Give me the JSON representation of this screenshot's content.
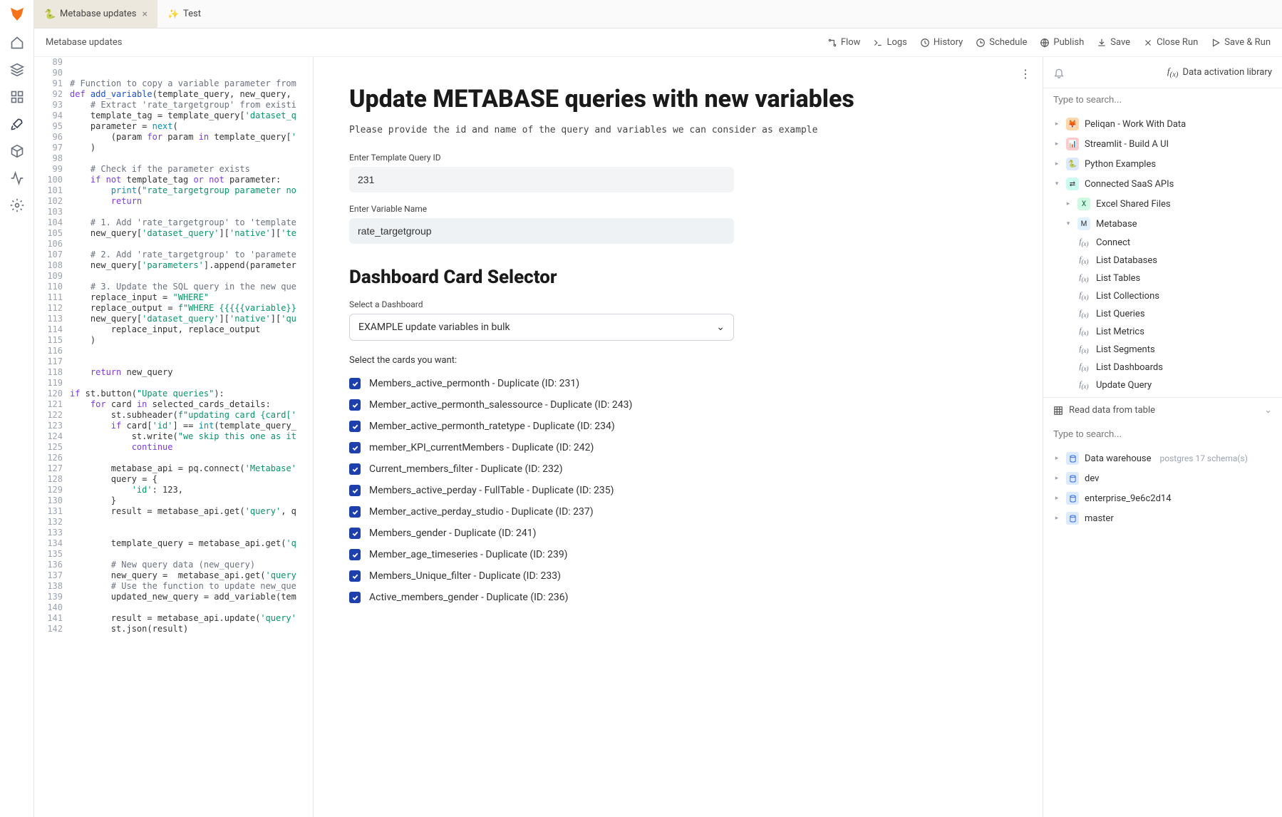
{
  "tabs": [
    {
      "label": "Metabase updates",
      "active": true
    },
    {
      "label": "Test",
      "active": false
    }
  ],
  "breadcrumb": "Metabase updates",
  "toolbar": {
    "flow": "Flow",
    "logs": "Logs",
    "history": "History",
    "schedule": "Schedule",
    "publish": "Publish",
    "save": "Save",
    "close_run": "Close Run",
    "save_run": "Save & Run"
  },
  "code": [
    {
      "n": 89,
      "t": ""
    },
    {
      "n": 90,
      "t": ""
    },
    {
      "n": 91,
      "t": "<span class='tok-comment'># Function to copy a variable parameter from</span>"
    },
    {
      "n": 92,
      "t": "<span class='tok-keyword'>def</span> <span class='tok-def'>add_variable</span>(template_query, new_query,"
    },
    {
      "n": 93,
      "t": "    <span class='tok-comment'># Extract 'rate_targetgroup' from existi</span>"
    },
    {
      "n": 94,
      "t": "    template_tag = template_query[<span class='tok-string'>'dataset_q</span>"
    },
    {
      "n": 95,
      "t": "    parameter = <span class='tok-builtin'>next</span>("
    },
    {
      "n": 96,
      "t": "        (param <span class='tok-keyword'>for</span> param <span class='tok-keyword'>in</span> template_query[<span class='tok-string'>'</span>"
    },
    {
      "n": 97,
      "t": "    )"
    },
    {
      "n": 98,
      "t": ""
    },
    {
      "n": 99,
      "t": "    <span class='tok-comment'># Check if the parameter exists</span>"
    },
    {
      "n": 100,
      "t": "    <span class='tok-keyword'>if</span> <span class='tok-keyword'>not</span> template_tag <span class='tok-keyword'>or</span> <span class='tok-keyword'>not</span> parameter:"
    },
    {
      "n": 101,
      "t": "        <span class='tok-builtin'>print</span>(<span class='tok-string'>\"rate_targetgroup parameter no</span>"
    },
    {
      "n": 102,
      "t": "        <span class='tok-keyword'>return</span>"
    },
    {
      "n": 103,
      "t": ""
    },
    {
      "n": 104,
      "t": "    <span class='tok-comment'># 1. Add 'rate_targetgroup' to 'template</span>"
    },
    {
      "n": 105,
      "t": "    new_query[<span class='tok-string'>'dataset_query'</span>][<span class='tok-string'>'native'</span>][<span class='tok-string'>'te</span>"
    },
    {
      "n": 106,
      "t": ""
    },
    {
      "n": 107,
      "t": "    <span class='tok-comment'># 2. Add 'rate_targetgroup' to 'paramete</span>"
    },
    {
      "n": 108,
      "t": "    new_query[<span class='tok-string'>'parameters'</span>].append(parameter"
    },
    {
      "n": 109,
      "t": ""
    },
    {
      "n": 110,
      "t": "    <span class='tok-comment'># 3. Update the SQL query in the new que</span>"
    },
    {
      "n": 111,
      "t": "    replace_input = <span class='tok-string'>\"WHERE\"</span>"
    },
    {
      "n": 112,
      "t": "    replace_output = <span class='tok-string'>f\"WHERE {{{{{variable}}</span>"
    },
    {
      "n": 113,
      "t": "    new_query[<span class='tok-string'>'dataset_query'</span>][<span class='tok-string'>'native'</span>][<span class='tok-string'>'qu</span>"
    },
    {
      "n": 114,
      "t": "        replace_input, replace_output"
    },
    {
      "n": 115,
      "t": "    )"
    },
    {
      "n": 116,
      "t": ""
    },
    {
      "n": 117,
      "t": ""
    },
    {
      "n": 118,
      "t": "    <span class='tok-keyword'>return</span> new_query"
    },
    {
      "n": 119,
      "t": ""
    },
    {
      "n": 120,
      "t": "<span class='tok-keyword'>if</span> st.button(<span class='tok-string'>\"Upate queries\"</span>):"
    },
    {
      "n": 121,
      "t": "    <span class='tok-keyword'>for</span> card <span class='tok-keyword'>in</span> selected_cards_details:"
    },
    {
      "n": 122,
      "t": "        st.subheader(<span class='tok-string'>f\"updating card {card['</span>"
    },
    {
      "n": 123,
      "t": "        <span class='tok-keyword'>if</span> card[<span class='tok-string'>'id'</span>] == <span class='tok-builtin'>int</span>(template_query_"
    },
    {
      "n": 124,
      "t": "            st.write(<span class='tok-string'>\"we skip this one as it</span>"
    },
    {
      "n": 125,
      "t": "            <span class='tok-keyword'>continue</span>"
    },
    {
      "n": 126,
      "t": ""
    },
    {
      "n": 127,
      "t": "        metabase_api = pq.connect(<span class='tok-string'>'Metabase'</span>"
    },
    {
      "n": 128,
      "t": "        query = {"
    },
    {
      "n": 129,
      "t": "            <span class='tok-string'>'id'</span>: 123,"
    },
    {
      "n": 130,
      "t": "        }"
    },
    {
      "n": 131,
      "t": "        result = metabase_api.get(<span class='tok-string'>'query'</span>, q"
    },
    {
      "n": 132,
      "t": ""
    },
    {
      "n": 133,
      "t": ""
    },
    {
      "n": 134,
      "t": "        template_query = metabase_api.get(<span class='tok-string'>'q</span>"
    },
    {
      "n": 135,
      "t": ""
    },
    {
      "n": 136,
      "t": "        <span class='tok-comment'># New query data (new_query)</span>"
    },
    {
      "n": 137,
      "t": "        new_query =  metabase_api.get(<span class='tok-string'>'query</span>"
    },
    {
      "n": 138,
      "t": "        <span class='tok-comment'># Use the function to update new_que</span>"
    },
    {
      "n": 139,
      "t": "        updated_new_query = add_variable(tem"
    },
    {
      "n": 140,
      "t": ""
    },
    {
      "n": 141,
      "t": "        result = metabase_api.update(<span class='tok-string'>'query'</span>"
    },
    {
      "n": 142,
      "t": "        st.json(result)"
    }
  ],
  "preview": {
    "title": "Update METABASE queries with new variables",
    "desc": "Please provide the id and name of the query and variables we can consider as example",
    "template_id_label": "Enter Template Query ID",
    "template_id_value": "231",
    "var_name_label": "Enter Variable Name",
    "var_name_value": "rate_targetgroup",
    "selector_title": "Dashboard Card Selector",
    "dashboard_label": "Select a Dashboard",
    "dashboard_value": "EXAMPLE update variables in bulk",
    "cards_label": "Select the cards you want:",
    "cards": [
      "Members_active_permonth - Duplicate (ID: 231)",
      "Member_active_permonth_salessource - Duplicate (ID: 243)",
      "Member_active_permonth_ratetype - Duplicate (ID: 234)",
      "member_KPI_currentMembers - Duplicate (ID: 242)",
      "Current_members_filter - Duplicate (ID: 232)",
      "Members_active_perday - FullTable - Duplicate (ID: 235)",
      "Member_active_perday_studio - Duplicate (ID: 237)",
      "Members_gender - Duplicate (ID: 241)",
      "Member_age_timeseries - Duplicate (ID: 239)",
      "Members_Unique_filter - Duplicate (ID: 233)",
      "Active_members_gender - Duplicate (ID: 236)"
    ]
  },
  "library": {
    "title": "Data activation library",
    "search_placeholder": "Type to search...",
    "items": {
      "peliqan": "Peliqan - Work With Data",
      "streamlit": "Streamlit - Build A UI",
      "python": "Python Examples",
      "saas": "Connected SaaS APIs",
      "excel": "Excel Shared Files",
      "metabase": "Metabase",
      "connect": "Connect",
      "list_db": "List Databases",
      "list_tables": "List Tables",
      "list_coll": "List Collections",
      "list_queries": "List Queries",
      "list_metrics": "List Metrics",
      "list_segments": "List Segments",
      "list_dash": "List Dashboards",
      "update_query": "Update Query"
    },
    "read_table": "Read data from table",
    "search2_placeholder": "Type to search...",
    "db": {
      "warehouse": "Data warehouse",
      "warehouse_note": "postgres 17 schema(s)",
      "dev": "dev",
      "enterprise": "enterprise_9e6c2d14",
      "master": "master"
    }
  }
}
